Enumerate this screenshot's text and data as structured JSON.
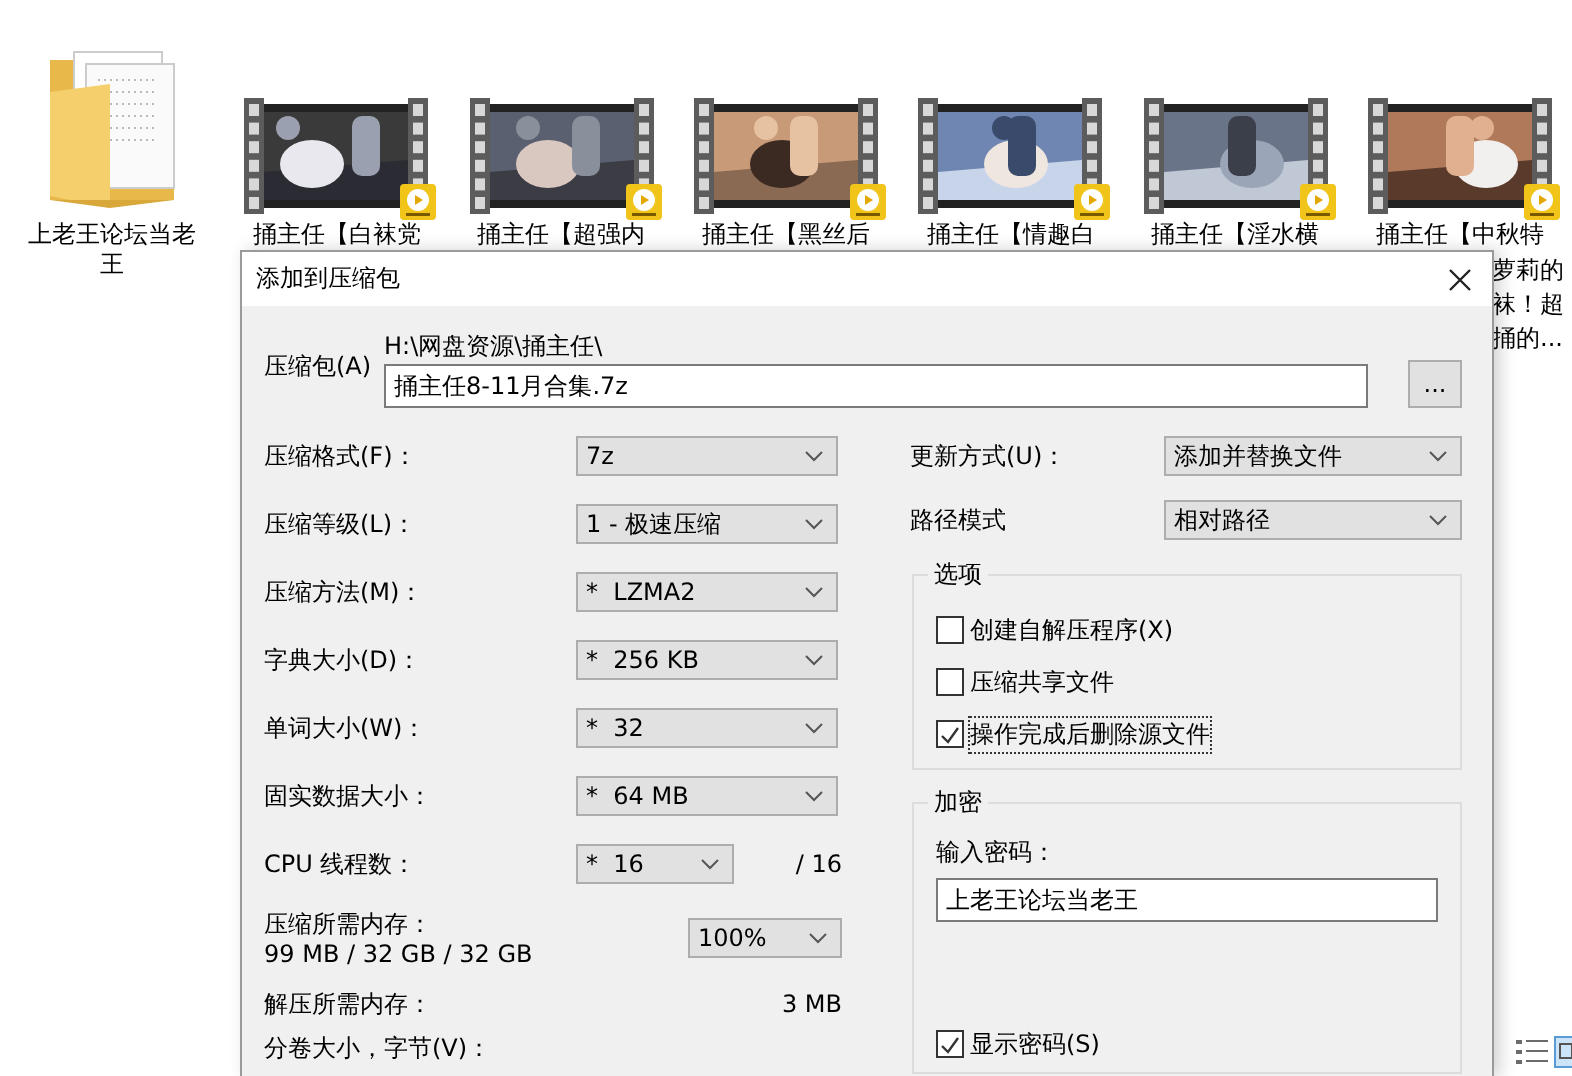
{
  "desktop_icons": [
    {
      "kind": "folder",
      "label": "上老王论坛当老王"
    },
    {
      "kind": "video",
      "label": "捅主任【白袜党"
    },
    {
      "kind": "video",
      "label": "捅主任【超强内"
    },
    {
      "kind": "video",
      "label": "捅主任【黑丝后"
    },
    {
      "kind": "video",
      "label": "捅主任【情趣白"
    },
    {
      "kind": "video",
      "label": "捅主任【淫水横"
    },
    {
      "kind": "video",
      "label": "捅主任【中秋特",
      "label_continued": [
        "萝莉的",
        "袜！超",
        "捅的..."
      ]
    }
  ],
  "dialog": {
    "title": "添加到压缩包",
    "archive": {
      "label": "压缩包(A)",
      "path": "H:\\网盘资源\\捅主任\\",
      "value": "捅主任8-11月合集.7z",
      "browse_button": "..."
    },
    "left_settings": [
      {
        "kind": "dropdown",
        "label": "压缩格式(F)：",
        "value": "7z"
      },
      {
        "kind": "dropdown",
        "label": "压缩等级(L)：",
        "value": "1 - 极速压缩"
      },
      {
        "kind": "dropdown",
        "label": "压缩方法(M)：",
        "value": "*  LZMA2"
      },
      {
        "kind": "dropdown",
        "label": "字典大小(D)：",
        "value": "*  256 KB"
      },
      {
        "kind": "dropdown",
        "label": "单词大小(W)：",
        "value": "*  32"
      },
      {
        "kind": "dropdown",
        "label": "固实数据大小：",
        "value": "*  64 MB"
      },
      {
        "kind": "threads",
        "label": "CPU 线程数：",
        "value": "*  16",
        "total": "/ 16"
      },
      {
        "kind": "memory",
        "label": "压缩所需内存：",
        "detail": "99 MB / 32 GB / 32 GB",
        "value": "100%"
      },
      {
        "kind": "reading",
        "label": "解压所需内存：",
        "value": "3 MB"
      },
      {
        "kind": "label",
        "label": "分卷大小，字节(V)："
      }
    ],
    "right_settings": [
      {
        "label": "更新方式(U)：",
        "value": "添加并替换文件"
      },
      {
        "label": "路径模式",
        "value": "相对路径"
      }
    ],
    "options": {
      "title": "选项",
      "items": [
        {
          "label": "创建自解压程序(X)",
          "checked": false,
          "focused": false
        },
        {
          "label": "压缩共享文件",
          "checked": false,
          "focused": false
        },
        {
          "label": "操作完成后删除源文件",
          "checked": true,
          "focused": true
        }
      ]
    },
    "encryption": {
      "title": "加密",
      "password_label": "输入密码：",
      "password": "上老王论坛当老王",
      "show_password": {
        "label": "显示密码(S)",
        "checked": true
      }
    }
  }
}
